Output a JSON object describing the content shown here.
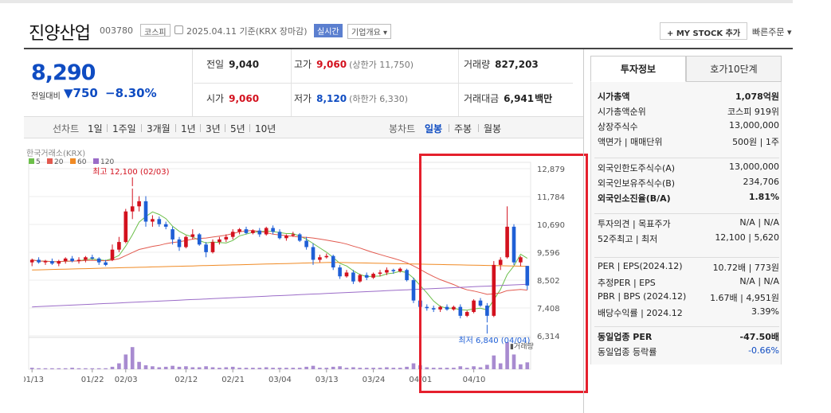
{
  "header": {
    "name": "진양산업",
    "code": "003780",
    "market": "코스피",
    "basis": "2025.04.11 기준(KRX 장마감)",
    "realtime_label": "실시간",
    "overview_label": "기업개요 ▾",
    "mystock_label": "+ MY STOCK 추가",
    "quick_order": "빠른주문 ▾"
  },
  "price": {
    "current": "8,290",
    "prev_label": "전일대비",
    "change": "▼750",
    "change_pct": "−8.30%"
  },
  "stats": {
    "prev_close": {
      "label": "전일",
      "value": "9,040"
    },
    "high": {
      "label": "고가",
      "value": "9,060",
      "sub": "(상한가 11,750)"
    },
    "volume": {
      "label": "거래량",
      "value": "827,203"
    },
    "open": {
      "label": "시가",
      "value": "9,060"
    },
    "low": {
      "label": "저가",
      "value": "8,120",
      "sub": "(하한가 6,330)"
    },
    "amount": {
      "label": "거래대금",
      "value": "6,941",
      "unit": "백만"
    }
  },
  "chart_tabs": {
    "left_label": "선차트",
    "periods": [
      "1일",
      "1주일",
      "3개월",
      "1년",
      "3년",
      "5년",
      "10년"
    ],
    "right_label": "봉차트",
    "candle_periods": [
      "일봉",
      "주봉",
      "월봉"
    ],
    "selected": "일봉"
  },
  "chart_data": {
    "type": "candlestick",
    "source_label": "한국거래소(KRX)",
    "legend": [
      {
        "name": "5",
        "color": "#6cbf4a"
      },
      {
        "name": "20",
        "color": "#e25a4f"
      },
      {
        "name": "60",
        "color": "#f08a24"
      },
      {
        "name": "120",
        "color": "#9b6cc8"
      }
    ],
    "y_ticks": [
      "12,879",
      "11,784",
      "10,690",
      "9,596",
      "8,502",
      "7,408",
      "6,314"
    ],
    "ylim": [
      6314,
      12879
    ],
    "x_ticks": [
      "01/13",
      "01/22",
      "02/03",
      "02/12",
      "02/21",
      "03/04",
      "03/13",
      "03/24",
      "04/01",
      "04/10"
    ],
    "high_annotation": "최고 12,100 (02/03)",
    "low_annotation": "최저 6,840 (04/04)",
    "volume_label": "거래량",
    "colors": {
      "up": "#d3111e",
      "down": "#1f5fd6"
    },
    "candles": [
      [
        9200,
        9350,
        9050,
        9300
      ],
      [
        9300,
        9400,
        9150,
        9200
      ],
      [
        9200,
        9300,
        9100,
        9250
      ],
      [
        9250,
        9350,
        9100,
        9150
      ],
      [
        9150,
        9300,
        9050,
        9250
      ],
      [
        9250,
        9400,
        9150,
        9350
      ],
      [
        9350,
        9450,
        9200,
        9250
      ],
      [
        9250,
        9400,
        9150,
        9300
      ],
      [
        9300,
        9450,
        9200,
        9400
      ],
      [
        9400,
        9500,
        9300,
        9350
      ],
      [
        9350,
        9400,
        9100,
        9200
      ],
      [
        9200,
        9300,
        9050,
        9100
      ],
      [
        9300,
        9900,
        9250,
        9700
      ],
      [
        9700,
        10200,
        9600,
        10000
      ],
      [
        10000,
        11300,
        9950,
        11200
      ],
      [
        11200,
        12100,
        10900,
        11400
      ],
      [
        11400,
        11800,
        11200,
        11600
      ],
      [
        11600,
        11800,
        10600,
        10800
      ],
      [
        10800,
        11050,
        10600,
        10900
      ],
      [
        10900,
        11000,
        10600,
        10700
      ],
      [
        10700,
        10800,
        10500,
        10600
      ],
      [
        10500,
        10600,
        9900,
        10100
      ],
      [
        10100,
        10200,
        9650,
        9800
      ],
      [
        9800,
        10250,
        9750,
        10200
      ],
      [
        10200,
        10500,
        10100,
        10300
      ],
      [
        10300,
        10350,
        9850,
        9900
      ],
      [
        9900,
        10000,
        9400,
        9600
      ],
      [
        9600,
        10100,
        9550,
        10000
      ],
      [
        10000,
        10200,
        9900,
        10100
      ],
      [
        10100,
        10300,
        10000,
        10200
      ],
      [
        10200,
        10500,
        10100,
        10400
      ],
      [
        10400,
        10550,
        10300,
        10500
      ],
      [
        10500,
        10600,
        10300,
        10350
      ],
      [
        10350,
        10500,
        10300,
        10450
      ],
      [
        10450,
        10550,
        10200,
        10300
      ],
      [
        10300,
        10600,
        10250,
        10550
      ],
      [
        10550,
        10650,
        10300,
        10400
      ],
      [
        10400,
        10500,
        10100,
        10150
      ],
      [
        10150,
        10300,
        10050,
        10250
      ],
      [
        10250,
        10400,
        10200,
        10300
      ],
      [
        10300,
        10350,
        10000,
        10050
      ],
      [
        10050,
        10200,
        9700,
        9800
      ],
      [
        9800,
        9950,
        9100,
        9300
      ],
      [
        9300,
        9500,
        9200,
        9400
      ],
      [
        9400,
        9550,
        9350,
        9450
      ],
      [
        9450,
        9500,
        8900,
        9000
      ],
      [
        9000,
        9100,
        8550,
        8650
      ],
      [
        8650,
        8900,
        8600,
        8800
      ],
      [
        8800,
        8900,
        8350,
        8450
      ],
      [
        8450,
        8750,
        8400,
        8700
      ],
      [
        8700,
        8800,
        8500,
        8600
      ],
      [
        8600,
        8800,
        8550,
        8750
      ],
      [
        8750,
        8900,
        8650,
        8800
      ],
      [
        8800,
        9000,
        8700,
        8900
      ],
      [
        8900,
        8950,
        8750,
        8850
      ],
      [
        8850,
        9000,
        8800,
        8950
      ],
      [
        8900,
        8950,
        8450,
        8500
      ],
      [
        8500,
        8600,
        7600,
        7700
      ],
      [
        7700,
        7800,
        7300,
        7450
      ],
      [
        7450,
        7550,
        7300,
        7400
      ],
      [
        7400,
        7500,
        7250,
        7350
      ],
      [
        7350,
        7500,
        7250,
        7450
      ],
      [
        7450,
        7550,
        7300,
        7350
      ],
      [
        7350,
        7500,
        7300,
        7450
      ],
      [
        7450,
        7550,
        7000,
        7100
      ],
      [
        7100,
        7300,
        7050,
        7250
      ],
      [
        7250,
        7750,
        7200,
        7700
      ],
      [
        7700,
        7800,
        7450,
        7500
      ],
      [
        7500,
        7600,
        6840,
        7100
      ],
      [
        7100,
        9250,
        7050,
        9100
      ],
      [
        9100,
        9400,
        8900,
        9300
      ],
      [
        9400,
        11400,
        9350,
        10600
      ],
      [
        10600,
        10700,
        9100,
        9200
      ],
      [
        9200,
        9450,
        9050,
        9400
      ],
      [
        9060,
        9060,
        8120,
        8290
      ]
    ],
    "volumes": [
      3,
      2,
      2,
      2,
      2,
      2,
      3,
      2,
      2,
      2,
      2,
      2,
      5,
      12,
      30,
      45,
      15,
      8,
      6,
      4,
      5,
      7,
      5,
      6,
      4,
      4,
      6,
      4,
      3,
      4,
      5,
      3,
      3,
      3,
      3,
      4,
      3,
      3,
      3,
      3,
      3,
      5,
      7,
      3,
      3,
      5,
      6,
      3,
      4,
      3,
      3,
      3,
      3,
      4,
      3,
      3,
      5,
      12,
      8,
      4,
      3,
      3,
      3,
      3,
      6,
      3,
      6,
      4,
      9,
      28,
      12,
      55,
      30,
      10,
      14
    ]
  },
  "side": {
    "tab1": "투자정보",
    "tab2": "호가10단계",
    "rows1": [
      {
        "l": "시가총액",
        "r": "1,078억원",
        "bold": true
      },
      {
        "l": "시가총액순위",
        "r": "코스피 919위"
      },
      {
        "l": "상장주식수",
        "r": "13,000,000"
      },
      {
        "l": "액면가 | 매매단위",
        "r": "500원 | 1주"
      }
    ],
    "rows2": [
      {
        "l": "외국인한도주식수(A)",
        "r": "13,000,000"
      },
      {
        "l": "외국인보유주식수(B)",
        "r": "234,706"
      },
      {
        "l": "외국인소진율(B/A)",
        "r": "1.81%",
        "bold": true
      }
    ],
    "rows3": [
      {
        "l": "투자의견 | 목표주가",
        "r": "N/A | N/A"
      },
      {
        "l": "52주최고 | 최저",
        "r": "12,100 | 5,620"
      }
    ],
    "rows4": [
      {
        "l": "PER | EPS(2024.12)",
        "r": "10.72배 | 773원"
      },
      {
        "l": "추정PER | EPS",
        "r": "N/A | N/A"
      },
      {
        "l": "PBR | BPS (2024.12)",
        "r": "1.67배 | 4,951원"
      },
      {
        "l": "배당수익률 | 2024.12",
        "r": "3.39%"
      }
    ],
    "rows5": [
      {
        "l": "동일업종 PER",
        "r": "-47.50배",
        "bold": true
      },
      {
        "l": "동일업종 등락률",
        "r": "-0.66%",
        "blue": true
      }
    ]
  }
}
